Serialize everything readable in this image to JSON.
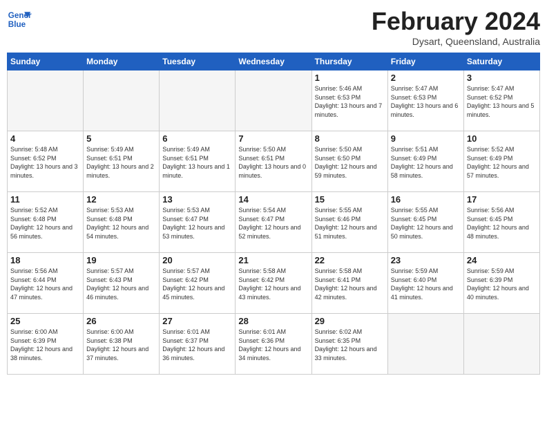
{
  "logo": {
    "line1": "General",
    "line2": "Blue"
  },
  "title": "February 2024",
  "location": "Dysart, Queensland, Australia",
  "days_of_week": [
    "Sunday",
    "Monday",
    "Tuesday",
    "Wednesday",
    "Thursday",
    "Friday",
    "Saturday"
  ],
  "weeks": [
    [
      {
        "day": "",
        "empty": true
      },
      {
        "day": "",
        "empty": true
      },
      {
        "day": "",
        "empty": true
      },
      {
        "day": "",
        "empty": true
      },
      {
        "day": "1",
        "sunrise": "Sunrise: 5:46 AM",
        "sunset": "Sunset: 6:53 PM",
        "daylight": "Daylight: 13 hours and 7 minutes."
      },
      {
        "day": "2",
        "sunrise": "Sunrise: 5:47 AM",
        "sunset": "Sunset: 6:53 PM",
        "daylight": "Daylight: 13 hours and 6 minutes."
      },
      {
        "day": "3",
        "sunrise": "Sunrise: 5:47 AM",
        "sunset": "Sunset: 6:52 PM",
        "daylight": "Daylight: 13 hours and 5 minutes."
      }
    ],
    [
      {
        "day": "4",
        "sunrise": "Sunrise: 5:48 AM",
        "sunset": "Sunset: 6:52 PM",
        "daylight": "Daylight: 13 hours and 3 minutes."
      },
      {
        "day": "5",
        "sunrise": "Sunrise: 5:49 AM",
        "sunset": "Sunset: 6:51 PM",
        "daylight": "Daylight: 13 hours and 2 minutes."
      },
      {
        "day": "6",
        "sunrise": "Sunrise: 5:49 AM",
        "sunset": "Sunset: 6:51 PM",
        "daylight": "Daylight: 13 hours and 1 minute."
      },
      {
        "day": "7",
        "sunrise": "Sunrise: 5:50 AM",
        "sunset": "Sunset: 6:51 PM",
        "daylight": "Daylight: 13 hours and 0 minutes."
      },
      {
        "day": "8",
        "sunrise": "Sunrise: 5:50 AM",
        "sunset": "Sunset: 6:50 PM",
        "daylight": "Daylight: 12 hours and 59 minutes."
      },
      {
        "day": "9",
        "sunrise": "Sunrise: 5:51 AM",
        "sunset": "Sunset: 6:49 PM",
        "daylight": "Daylight: 12 hours and 58 minutes."
      },
      {
        "day": "10",
        "sunrise": "Sunrise: 5:52 AM",
        "sunset": "Sunset: 6:49 PM",
        "daylight": "Daylight: 12 hours and 57 minutes."
      }
    ],
    [
      {
        "day": "11",
        "sunrise": "Sunrise: 5:52 AM",
        "sunset": "Sunset: 6:48 PM",
        "daylight": "Daylight: 12 hours and 56 minutes."
      },
      {
        "day": "12",
        "sunrise": "Sunrise: 5:53 AM",
        "sunset": "Sunset: 6:48 PM",
        "daylight": "Daylight: 12 hours and 54 minutes."
      },
      {
        "day": "13",
        "sunrise": "Sunrise: 5:53 AM",
        "sunset": "Sunset: 6:47 PM",
        "daylight": "Daylight: 12 hours and 53 minutes."
      },
      {
        "day": "14",
        "sunrise": "Sunrise: 5:54 AM",
        "sunset": "Sunset: 6:47 PM",
        "daylight": "Daylight: 12 hours and 52 minutes."
      },
      {
        "day": "15",
        "sunrise": "Sunrise: 5:55 AM",
        "sunset": "Sunset: 6:46 PM",
        "daylight": "Daylight: 12 hours and 51 minutes."
      },
      {
        "day": "16",
        "sunrise": "Sunrise: 5:55 AM",
        "sunset": "Sunset: 6:45 PM",
        "daylight": "Daylight: 12 hours and 50 minutes."
      },
      {
        "day": "17",
        "sunrise": "Sunrise: 5:56 AM",
        "sunset": "Sunset: 6:45 PM",
        "daylight": "Daylight: 12 hours and 48 minutes."
      }
    ],
    [
      {
        "day": "18",
        "sunrise": "Sunrise: 5:56 AM",
        "sunset": "Sunset: 6:44 PM",
        "daylight": "Daylight: 12 hours and 47 minutes."
      },
      {
        "day": "19",
        "sunrise": "Sunrise: 5:57 AM",
        "sunset": "Sunset: 6:43 PM",
        "daylight": "Daylight: 12 hours and 46 minutes."
      },
      {
        "day": "20",
        "sunrise": "Sunrise: 5:57 AM",
        "sunset": "Sunset: 6:42 PM",
        "daylight": "Daylight: 12 hours and 45 minutes."
      },
      {
        "day": "21",
        "sunrise": "Sunrise: 5:58 AM",
        "sunset": "Sunset: 6:42 PM",
        "daylight": "Daylight: 12 hours and 43 minutes."
      },
      {
        "day": "22",
        "sunrise": "Sunrise: 5:58 AM",
        "sunset": "Sunset: 6:41 PM",
        "daylight": "Daylight: 12 hours and 42 minutes."
      },
      {
        "day": "23",
        "sunrise": "Sunrise: 5:59 AM",
        "sunset": "Sunset: 6:40 PM",
        "daylight": "Daylight: 12 hours and 41 minutes."
      },
      {
        "day": "24",
        "sunrise": "Sunrise: 5:59 AM",
        "sunset": "Sunset: 6:39 PM",
        "daylight": "Daylight: 12 hours and 40 minutes."
      }
    ],
    [
      {
        "day": "25",
        "sunrise": "Sunrise: 6:00 AM",
        "sunset": "Sunset: 6:39 PM",
        "daylight": "Daylight: 12 hours and 38 minutes."
      },
      {
        "day": "26",
        "sunrise": "Sunrise: 6:00 AM",
        "sunset": "Sunset: 6:38 PM",
        "daylight": "Daylight: 12 hours and 37 minutes."
      },
      {
        "day": "27",
        "sunrise": "Sunrise: 6:01 AM",
        "sunset": "Sunset: 6:37 PM",
        "daylight": "Daylight: 12 hours and 36 minutes."
      },
      {
        "day": "28",
        "sunrise": "Sunrise: 6:01 AM",
        "sunset": "Sunset: 6:36 PM",
        "daylight": "Daylight: 12 hours and 34 minutes."
      },
      {
        "day": "29",
        "sunrise": "Sunrise: 6:02 AM",
        "sunset": "Sunset: 6:35 PM",
        "daylight": "Daylight: 12 hours and 33 minutes."
      },
      {
        "day": "",
        "empty": true
      },
      {
        "day": "",
        "empty": true
      }
    ]
  ]
}
